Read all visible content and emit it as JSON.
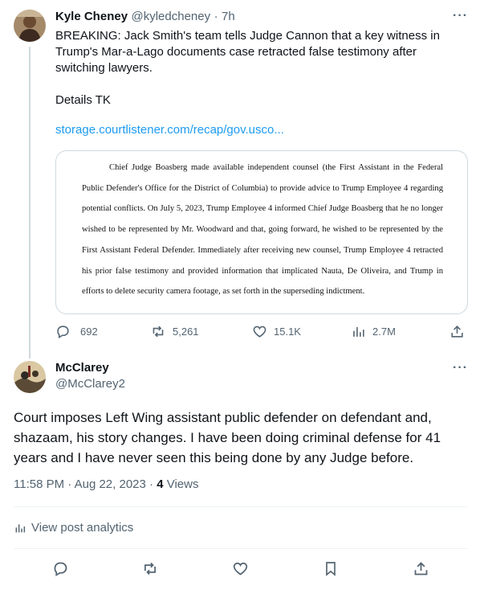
{
  "quoted_tweet": {
    "author_name": "Kyle Cheney",
    "handle": "@kyledcheney",
    "separator": "·",
    "time": "7h",
    "text_lines": [
      "BREAKING: Jack Smith's team tells Judge Cannon that a key witness in",
      "Trump's Mar-a-Lago documents case retracted false testimony after",
      "switching lawyers."
    ],
    "details": "Details TK",
    "link": "storage.courtlistener.com/recap/gov.usco...",
    "document_excerpt": "Chief Judge Boasberg made available independent counsel (the First Assistant in the Federal Public Defender's Office for the District of Columbia) to provide advice to Trump Employee 4 regarding potential conflicts. On July 5, 2023, Trump Employee 4 informed Chief Judge Boasberg that he no longer wished to be represented by Mr. Woodward and that, going forward, he wished to be represented by the First Assistant Federal Defender. Immediately after receiving new counsel, Trump Employee 4 retracted his prior false testimony and provided information that implicated Nauta, De Oliveira, and Trump in efforts to delete security camera footage, as set forth in the superseding indictment.",
    "stats": {
      "replies": "692",
      "reposts": "5,261",
      "likes": "15.1K",
      "views": "2.7M"
    }
  },
  "reply_tweet": {
    "author_name": "McClarey",
    "handle": "@McClarey2",
    "text": "Court imposes Left Wing assistant public defender on defendant and, shazaam, his story changes.  I have been doing criminal defense for 41 years and I have never seen this being done by any Judge before.",
    "time": "11:58 PM",
    "date": "Aug 22, 2023",
    "views_count": "4",
    "views_label": "Views",
    "analytics_label": "View post analytics"
  },
  "colors": {
    "accent": "#1d9bf0",
    "muted": "#536471",
    "border": "#cfd9de"
  }
}
